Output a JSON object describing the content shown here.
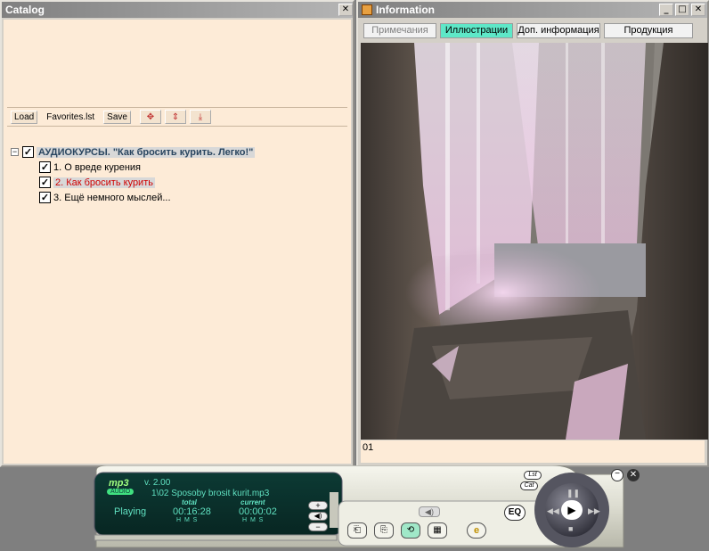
{
  "catalog": {
    "title": "Catalog",
    "toolbar": {
      "load": "Load",
      "file": "Favorites.lst",
      "save": "Save"
    },
    "tree": {
      "root": "АУДИОКУРСЫ. \"Как бросить курить. Легко!\"",
      "items": [
        "1. О вреде курения",
        "2. Как бросить курить",
        "3. Ещё немного мыслей..."
      ]
    }
  },
  "information": {
    "title": "Information",
    "tabs": [
      "Примечания",
      "Иллюстрации",
      "Доп. информация",
      "Продукция"
    ],
    "caption": "01"
  },
  "player": {
    "logo": "mp3",
    "logo_sub": "AUDIO",
    "version": "v. 2.00",
    "track": "1\\02 Sposoby brosit kurit.mp3",
    "status": "Playing",
    "total_label": "total",
    "total_time": "00:16:28",
    "current_label": "current",
    "current_time": "00:00:02",
    "hms": "H  M  S",
    "eq": "EQ",
    "lst": "Lst",
    "cat": "Cat"
  },
  "colors": {
    "panel_bg": "#fdebd7",
    "tab_active": "#5ee8c8",
    "selected_text": "#d00000"
  }
}
